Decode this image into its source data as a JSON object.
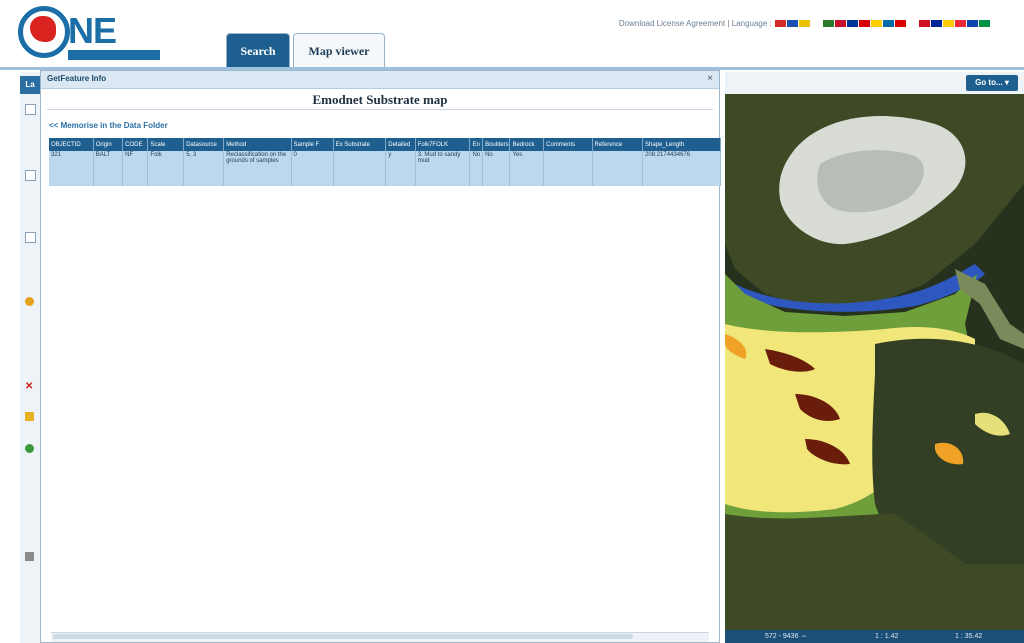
{
  "header": {
    "logo_text": "NE",
    "logo_subtitle": "",
    "top_links": {
      "license": "Download License Agreement",
      "separator": "|",
      "language_label": "Language :"
    },
    "language_flags": [
      "#d42a2a",
      "#1d4fb1",
      "#e6c200",
      "#ffffff",
      "#2b7a2b",
      "#c8102e",
      "#003399",
      "#d80000",
      "#ffcc00",
      "#006aa7",
      "#dd0000",
      "#ffffff",
      "#ce1126",
      "#002395",
      "#fecb00",
      "#ed2939",
      "#0f47af",
      "#009246"
    ],
    "tabs": [
      {
        "label": "Search",
        "active": false
      },
      {
        "label": "Map viewer",
        "active": true
      }
    ]
  },
  "left_panel": {
    "header_label": "La"
  },
  "dialog": {
    "title": "GetFeature Info",
    "close_glyph": "×",
    "heading": "Emodnet Substrate map",
    "folder_link": "<< Memorise in the Data Folder",
    "table": {
      "columns": [
        "OBJECTID",
        "Origin",
        "CODE",
        "Scale",
        "Datasource",
        "Method",
        "Sample F",
        "Ex Substrate",
        "Detailed",
        "Folk7FOLK",
        "En",
        "Boulders",
        "Bedrock",
        "Comments",
        "Reference",
        "Shape_Length"
      ],
      "rows": [
        [
          "321",
          "BALT",
          "NF",
          "Folk",
          "5, 3",
          "Reclassification on the grounds of samples",
          "0",
          "",
          "y",
          "3. Mud to sandy mud",
          "No",
          "No",
          "Yes",
          "",
          "",
          "208.2174434676"
        ]
      ]
    }
  },
  "map": {
    "goto_label": "Go to... ▾",
    "status": {
      "coords": "572 - 9436 ⇔",
      "scale1": "1 : 1.42",
      "scale2": "1 : 35.42"
    },
    "colors": {
      "sea": "#27321e",
      "land_forest": "#3d4a25",
      "snow": "#e9ece8",
      "sand": "#f0e67a",
      "green_habitat": "#6f9f3a",
      "orange": "#f0a226",
      "brown": "#6a1d0a",
      "blue": "#2e58c0"
    }
  }
}
